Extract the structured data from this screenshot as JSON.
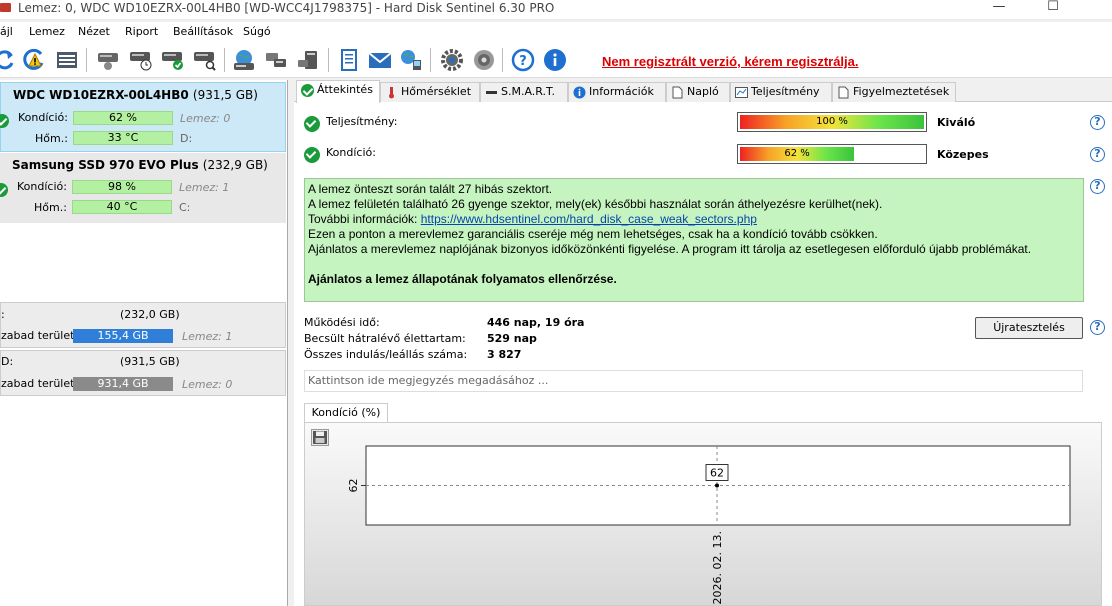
{
  "window": {
    "title": "Lemez: 0, WDC WD10EZRX-00L4HB0 [WD-WCC4J1798375]  -  Hard Disk Sentinel 6.30 PRO",
    "minimize": "—",
    "maximize": "☐"
  },
  "menu": [
    "ájl",
    "Lemez",
    "Nézet",
    "Riport",
    "Beállítások",
    "Súgó"
  ],
  "toolbar": {
    "registration_warning": "Nem regisztrált verzió, kérem regisztrálja.",
    "icons": [
      "refresh-icon",
      "refresh-warning-icon",
      "disk-list-icon",
      "disk-gray-icon",
      "disk-clock-icon",
      "disk-check-icon",
      "disk-search-icon",
      "disk-globe-icon",
      "disk-copy-icon",
      "disk-export-icon",
      "report-icon",
      "mail-icon",
      "network-icon",
      "gear-icon",
      "sound-icon",
      "help-icon",
      "info-icon"
    ]
  },
  "disks": [
    {
      "name": "WDC WD10EZRX-00L4HB0",
      "size": "(931,5 GB)",
      "health_label": "Kondíció:",
      "health_value": "62 %",
      "health": 0.62,
      "temp_label": "Hőm.:",
      "temp_value": "33 °C",
      "disk_label": "Lemez: 0",
      "drive": "D:"
    },
    {
      "name": "Samsung SSD 970 EVO Plus",
      "size": "(232,9 GB)",
      "health_label": "Kondíció:",
      "health_value": "98 %",
      "health": 0.98,
      "temp_label": "Hőm.:",
      "temp_value": "40 °C",
      "disk_label": "Lemez: 1",
      "drive": "C:"
    }
  ],
  "volumes": [
    {
      "letter": ":",
      "size": "(232,0 GB)",
      "free_label": "zabad terület",
      "free_value": "155,4 GB",
      "disk": "Lemez: 1",
      "color": "#2f7fd8"
    },
    {
      "letter": "D:",
      "size": "(931,5 GB)",
      "free_label": "zabad terület",
      "free_value": "931,4 GB",
      "disk": "Lemez: 0",
      "color": "#8a8a8a"
    }
  ],
  "tabs": [
    "Áttekintés",
    "Hőmérséklet",
    "S.M.A.R.T.",
    "Információk",
    "Napló",
    "Teljesítmény",
    "Figyelmeztetések"
  ],
  "overview": {
    "performance_label": "Teljesítmény:",
    "performance_value": "100 %",
    "performance": 1.0,
    "performance_rating": "Kiváló",
    "health_label": "Kondíció:",
    "health_value": "62 %",
    "health": 0.62,
    "health_rating": "Közepes",
    "info_lines": [
      "A lemez önteszt során talált 27 hibás szektort.",
      "A lemez felületén található 26 gyenge szektor, mely(ek) későbbi használat során áthelyezésre kerülhet(nek).",
      "Ezen a ponton a merevlemez garanciális cseréje még nem lehetséges, csak ha a kondíció tovább csökken.",
      "Ajánlatos a merevlemez naplójának bizonyos időközönkénti figyelése. A program itt tárolja az esetlegesen előforduló újabb problémákat."
    ],
    "more_info_label": "További információk:",
    "more_info_link": "https://www.hdsentinel.com/hard_disk_case_weak_sectors.php",
    "recommendation": "Ajánlatos a lemez állapotának folyamatos ellenőrzése.",
    "uptime_label": "Működési idő:",
    "uptime_value": "446 nap, 19 óra",
    "lifetime_label": "Becsült hátralévő élettartam:",
    "lifetime_value": "529 nap",
    "startstop_label": "Összes indulás/leállás száma:",
    "startstop_value": "3 827",
    "retest_button": "Újratesztelés",
    "note_placeholder": "Kattintson ide megjegyzés megadásához ...",
    "help": "?"
  },
  "chart_tab": "Kondíció  (%)",
  "chart_data": {
    "type": "line",
    "x": [
      "2026. 02. 13."
    ],
    "series": [
      {
        "values": [
          62
        ]
      }
    ],
    "y_tick_labels": [
      "62"
    ],
    "data_labels": [
      "62"
    ]
  }
}
